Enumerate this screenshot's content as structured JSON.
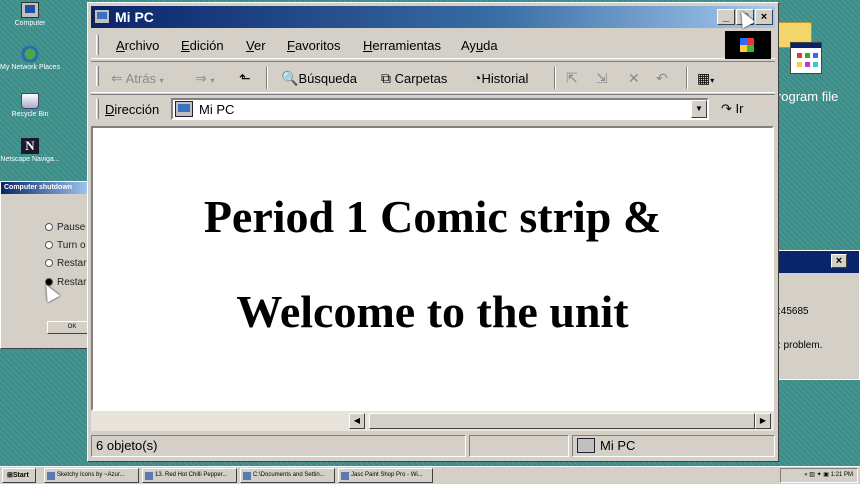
{
  "desktop": {
    "icons": [
      {
        "label": "Computer"
      },
      {
        "label": "My Network Places"
      },
      {
        "label": "Recycle Bin"
      },
      {
        "label": "Netscape Naviga..."
      }
    ],
    "shutdown": {
      "title": "Computer shutdown",
      "options": [
        "Pause",
        "Turn o",
        "Restar",
        "Restar"
      ],
      "ok_label": "OK"
    },
    "program_label": "program file",
    "error_dialog": {
      "close": "×",
      "code": ":45685",
      "message": ": problem."
    }
  },
  "window": {
    "title": "Mi PC",
    "controls": {
      "minimize": "_",
      "maximize": "□",
      "close": "×"
    },
    "menu": [
      {
        "key": "A",
        "rest": "rchivo"
      },
      {
        "key": "E",
        "rest": "dición"
      },
      {
        "key": "V",
        "rest": "er"
      },
      {
        "key": "F",
        "rest": "avoritos"
      },
      {
        "key": "H",
        "rest": "erramientas"
      },
      {
        "pre": "Ay",
        "key": "u",
        "rest": "da"
      }
    ],
    "toolbar": {
      "back": "Atrás",
      "search": "Búsqueda",
      "folders": "Carpetas",
      "history": "Historial"
    },
    "address": {
      "label_key": "D",
      "label_rest": "irección",
      "value": "Mi PC",
      "go": "Ir"
    },
    "content": {
      "line1": "Period 1 Comic strip &",
      "line2": "Welcome to the unit"
    },
    "status": {
      "objects": "6 objeto(s)",
      "zone": "Mi PC"
    }
  },
  "taskbar": {
    "start": "Start",
    "tasks": [
      "Sketchy Icons by ~Azur...",
      "13. Red Hot Chilli Pepper...",
      "C:\\Documents and Settin...",
      "Jasc Paint Shop Pro - Wi..."
    ],
    "clock": "1:21 PM"
  }
}
